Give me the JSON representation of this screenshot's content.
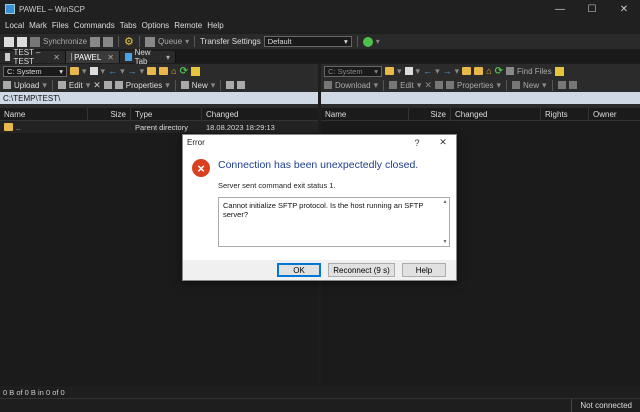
{
  "window": {
    "title": "PAWEL – WinSCP",
    "minimize": "—",
    "maximize": "☐",
    "close": "✕"
  },
  "menu": [
    "Local",
    "Mark",
    "Files",
    "Commands",
    "Tabs",
    "Options",
    "Remote",
    "Help"
  ],
  "toolbar": {
    "synchronize": "Synchronize",
    "queue": "Queue",
    "transfer_settings_label": "Transfer Settings",
    "transfer_settings_value": "Default"
  },
  "tabs": [
    {
      "label": "TEST – TEST",
      "close": "✕"
    },
    {
      "label": "PAWEL",
      "close": "✕"
    },
    {
      "label": "New Tab",
      "arrow": "▾"
    }
  ],
  "left_panel": {
    "drive": "C: System",
    "upload": "Upload",
    "edit": "Edit",
    "properties": "Properties",
    "new": "New",
    "path": "C:\\TEMP\\TEST\\",
    "columns": [
      "Name",
      "Size",
      "Type",
      "Changed"
    ],
    "rows": [
      {
        "name": "..",
        "size": "",
        "type": "Parent directory",
        "changed": "18.08.2023 18:29:13"
      }
    ]
  },
  "right_panel": {
    "drive": "C: System",
    "download": "Download",
    "edit": "Edit",
    "properties": "Properties",
    "new": "New",
    "find_files": "Find Files",
    "columns": [
      "Name",
      "Size",
      "Changed",
      "Rights",
      "Owner"
    ]
  },
  "status": {
    "left": "0 B of 0 B in 0 of 0",
    "connection": "Not connected"
  },
  "dialog": {
    "title": "Error",
    "help_glyph": "?",
    "close_glyph": "✕",
    "heading": "Connection has been unexpectedly closed.",
    "subtext": "Server sent command exit status 1.",
    "message": "Cannot initialize SFTP protocol. Is the host running an SFTP server?",
    "buttons": {
      "ok": "OK",
      "reconnect": "Reconnect (9 s)",
      "help": "Help"
    }
  },
  "colors": {
    "accent": "#0078d7",
    "error": "#d9401f",
    "heading": "#1f3e8c",
    "folder": "#e8b84a"
  }
}
